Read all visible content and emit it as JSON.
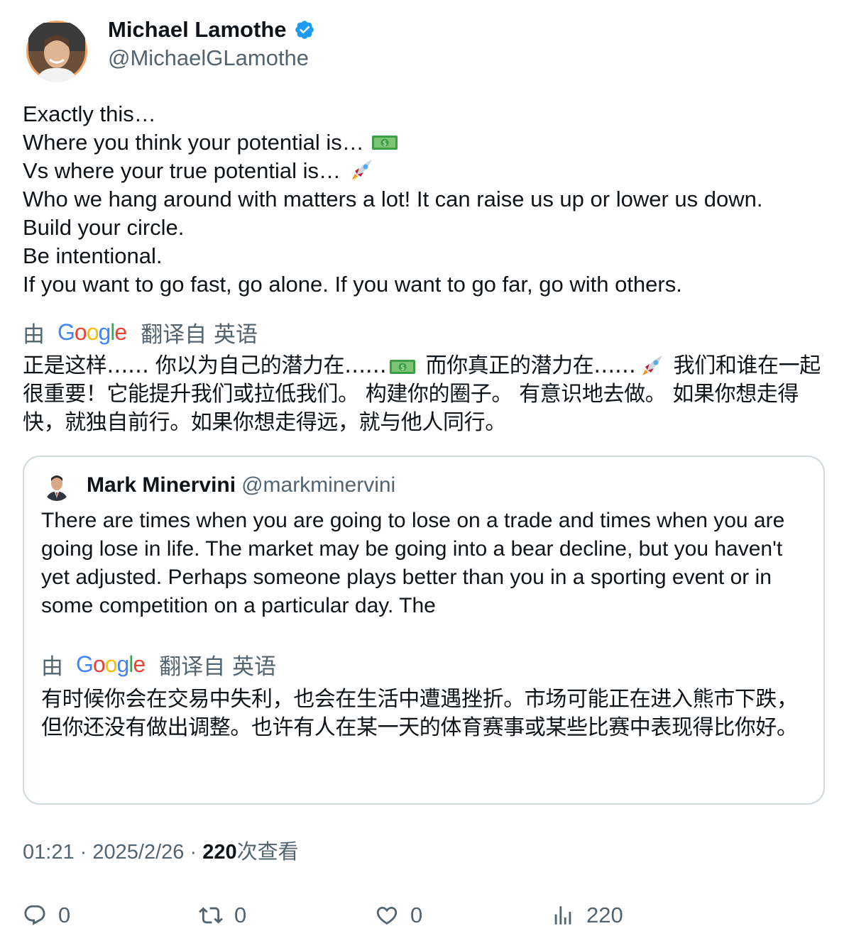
{
  "author": {
    "name": "Michael Lamothe",
    "handle": "@MichaelGLamothe",
    "verified": true,
    "avatar_icon": "person-avatar"
  },
  "tweet": {
    "lines": [
      "Exactly this…",
      "Where you think your potential is…",
      "Vs where your true potential is…",
      "Who we hang around with matters a lot! It can raise us up or lower us down.",
      "Build your circle.",
      "Be intentional.",
      "If you want to go fast, go alone. If you want to go far, go with others."
    ],
    "emojis": {
      "line2": "money-bill-emoji",
      "line3": "rocket-emoji"
    },
    "translation_bar": {
      "by": "由",
      "provider": "Google",
      "from": "翻译自 英语"
    },
    "translation": [
      "正是这样…… 你以为自己的潜力在……",
      " 而你真正的潜力在……",
      " 我们和谁在一起很重要！它能提升我们或拉低我们。 构建你的圈子。 有意识地去做。 如果你想走得快，就独自前行。如果你想走得远，就与他人同行。"
    ]
  },
  "quote": {
    "name": "Mark Minervini",
    "handle": "@markminervini",
    "text": "There are times when you are going to lose on a trade and times when you are going lose in life. The market may be going into a bear decline, but you haven't yet adjusted. Perhaps someone plays better than you in a sporting event or in some competition on a particular day. The",
    "translation_bar": {
      "by": "由",
      "provider": "Google",
      "from": "翻译自 英语"
    },
    "translation": "有时候你会在交易中失利，也会在生活中遭遇挫折。市场可能正在进入熊市下跌，但你还没有做出调整。也许有人在某一天的体育赛事或某些比赛中表现得比你好。"
  },
  "meta": {
    "time": "01:21",
    "separator": "·",
    "date": "2025/2/26",
    "views_count": "220",
    "views_label": "次查看"
  },
  "actions": {
    "reply_count": "0",
    "retweet_count": "0",
    "like_count": "0",
    "views_count": "220"
  },
  "colors": {
    "text": "#0f1419",
    "secondary": "#536471",
    "verified_blue": "#1d9bf0",
    "border": "#cfd9de"
  }
}
